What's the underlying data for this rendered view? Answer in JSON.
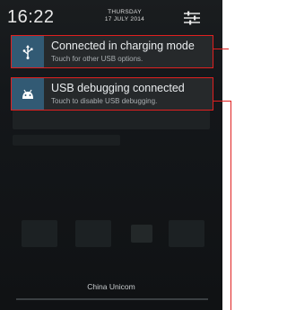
{
  "header": {
    "time": "16:22",
    "day": "THURSDAY",
    "date": "17 JULY 2014",
    "settings_icon": "quick-settings-sliders-icon"
  },
  "notifications": [
    {
      "icon": "usb-icon",
      "title": "Connected in charging mode",
      "subtitle": "Touch for other USB options."
    },
    {
      "icon": "android-debug-icon",
      "title": "USB debugging connected",
      "subtitle": "Touch to disable USB debugging."
    }
  ],
  "footer": {
    "carrier": "China Unicom"
  },
  "colors": {
    "highlight": "#e02020",
    "icon_bg": "#325a74",
    "shade_bg": "#14171a"
  }
}
